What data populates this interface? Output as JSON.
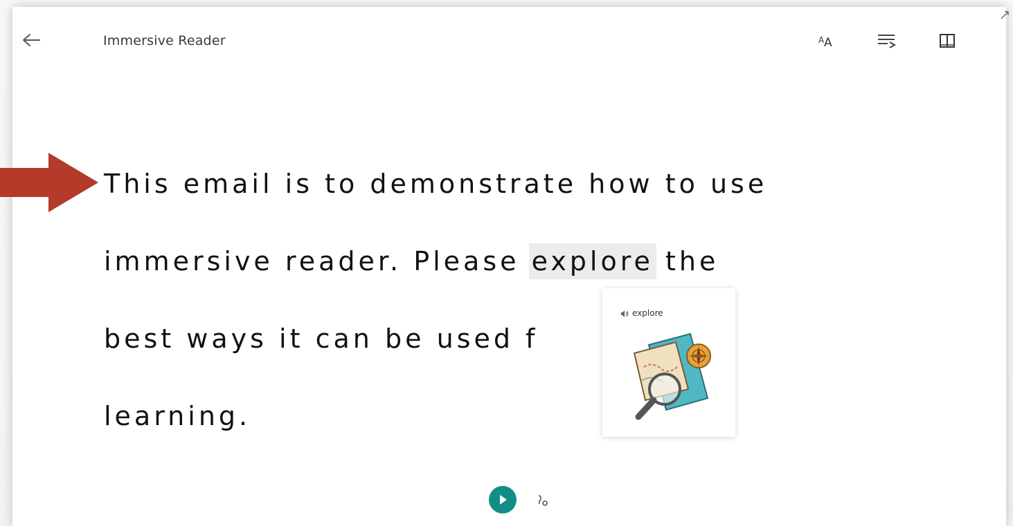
{
  "header": {
    "title": "Immersive Reader",
    "back_icon": "back-arrow-icon",
    "tools": [
      {
        "name": "text-preferences",
        "label": "AA",
        "icon": "text-preferences-icon"
      },
      {
        "name": "grammar-options",
        "icon": "grammar-options-icon"
      },
      {
        "name": "reading-preferences",
        "icon": "reading-preferences-icon"
      }
    ],
    "expand_icon": "expand-icon"
  },
  "reading": {
    "lines": [
      [
        "This",
        "email",
        "is",
        "to",
        "demonstrate",
        "how",
        "to",
        "use"
      ],
      [
        "immersive",
        "reader.",
        "Please",
        "explore",
        "the"
      ],
      [
        "best",
        "ways",
        "it",
        "can",
        "be",
        "used",
        "f"
      ],
      [
        "learning."
      ]
    ],
    "highlighted_word": "explore"
  },
  "picture_dictionary": {
    "word": "explore",
    "speaker_icon": "speaker-icon",
    "image_icon": "treasure-map-magnifier-icon"
  },
  "footer": {
    "play_icon": "play-icon",
    "voice_settings_icon": "voice-settings-icon"
  },
  "colors": {
    "accent": "#118f86",
    "callout_arrow": "#b43a2a",
    "highlight": "#ececec",
    "text": "#111111"
  }
}
